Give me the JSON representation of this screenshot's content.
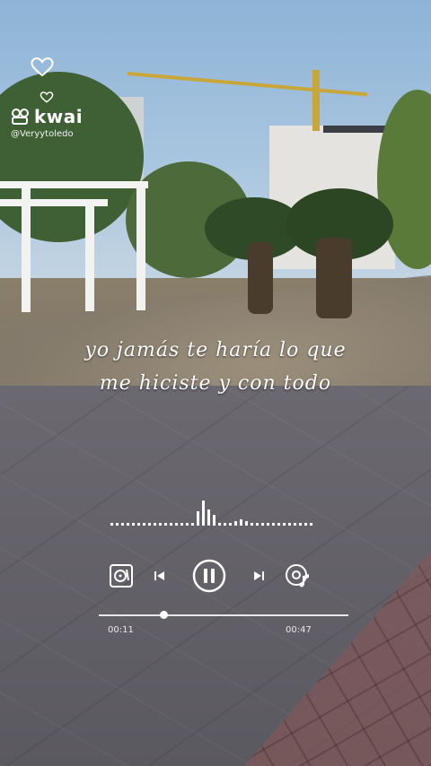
{
  "watermark": {
    "brand_name": "kwai",
    "handle": "@Veryytoledo",
    "icons": [
      "heart-outline-icon",
      "heart-small-icon",
      "kwai-logo-icon"
    ]
  },
  "lyrics": {
    "line1": "yo jamás te haría lo que",
    "line2": "me hiciste y con todo"
  },
  "player": {
    "current_time": "00:11",
    "total_time": "00:47",
    "progress": 0.26,
    "controls": [
      "vinyl-icon",
      "previous-icon",
      "pause-icon",
      "next-icon",
      "music-disc-icon"
    ]
  },
  "colors": {
    "text": "#ffffff",
    "sky": "#9fbfdc",
    "foliage": "#3d5a2e"
  }
}
